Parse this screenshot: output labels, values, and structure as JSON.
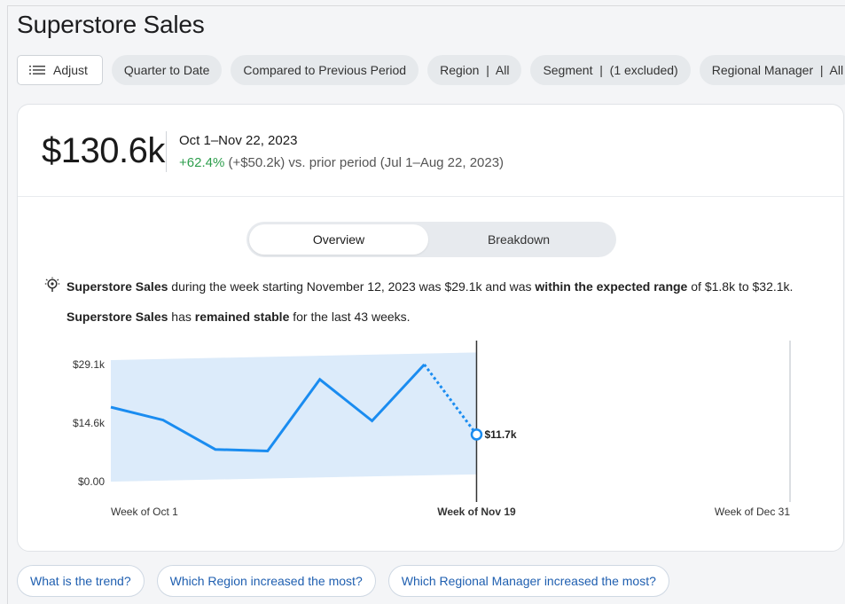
{
  "app": {
    "title": "Superstore Sales"
  },
  "toolbar": {
    "adjust_label": "Adjust",
    "filters": [
      "Quarter to Date",
      "Compared to Previous Period",
      "Region  |  All",
      "Segment  |  (1 excluded)",
      "Regional Manager  |  All"
    ]
  },
  "kpi": {
    "value": "$130.6k",
    "date_range": "Oct 1–Nov 22, 2023",
    "change_pct": "+62.4%",
    "change_rest": " (+$50.2k) vs. prior period (Jul 1–Aug 22, 2023)"
  },
  "tabs": {
    "overview": "Overview",
    "breakdown": "Breakdown",
    "active": "Overview"
  },
  "insight": {
    "line1": {
      "b1": "Superstore Sales",
      "t1": " during the week starting November 12, 2023 was $29.1k and was ",
      "b2": "within the expected range",
      "t2": " of $1.8k to $32.1k."
    },
    "line2": {
      "b1": "Superstore Sales",
      "t1": " has ",
      "b2": "remained stable",
      "t2": " for the last 43 weeks."
    }
  },
  "chart_data": {
    "type": "line",
    "y_ticks": [
      "$29.1k",
      "$14.6k",
      "$0.00"
    ],
    "y_tick_values": [
      29.1,
      14.6,
      0
    ],
    "ylim": [
      0,
      29.1
    ],
    "x_labels": [
      "Week of Oct 1",
      "Week of Nov 19",
      "Week of Dec 31"
    ],
    "x_range_weeks": [
      0,
      13
    ],
    "series": [
      {
        "values": [
          {
            "week": 0,
            "y": 18.5
          },
          {
            "week": 1,
            "y": 15.3
          },
          {
            "week": 2,
            "y": 8.0
          },
          {
            "week": 3,
            "y": 7.6
          },
          {
            "week": 4,
            "y": 25.4
          },
          {
            "week": 5,
            "y": 15.1
          },
          {
            "week": 6,
            "y": 29.1
          },
          {
            "week": 7,
            "y": 11.7
          }
        ]
      }
    ],
    "expected_range_band": {
      "start_low": 0,
      "start_high": 30.2,
      "end_low": 1.8,
      "end_high": 32.1
    },
    "current_label": "$11.7k",
    "current_week_label": "Week of Nov 19",
    "colors": {
      "line": "#1a8cf0",
      "band": "#dcebfa"
    }
  },
  "suggestions": [
    "What is the trend?",
    "Which Region increased the most?",
    "Which Regional Manager increased the most?"
  ]
}
